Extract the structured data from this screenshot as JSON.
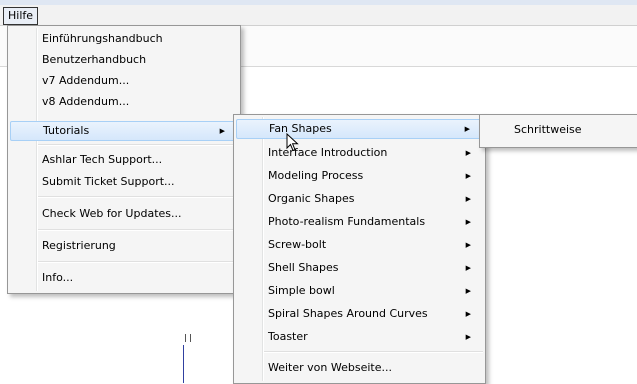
{
  "menubar": {
    "help_label": "Hilfe"
  },
  "help_menu": {
    "items": [
      {
        "label": "Einführungshandbuch"
      },
      {
        "label": "Benutzerhandbuch"
      },
      {
        "label": "v7 Addendum..."
      },
      {
        "label": "v8 Addendum..."
      },
      {
        "label": "Tutorials"
      },
      {
        "label": "Ashlar Tech Support..."
      },
      {
        "label": "Submit Ticket Support..."
      },
      {
        "label": "Check Web for Updates..."
      },
      {
        "label": "Registrierung"
      },
      {
        "label": "Info..."
      }
    ]
  },
  "tutorials_menu": {
    "items": [
      {
        "label": "Fan Shapes"
      },
      {
        "label": "Interface Introduction"
      },
      {
        "label": "Modeling Process"
      },
      {
        "label": "Organic Shapes"
      },
      {
        "label": "Photo-realism Fundamentals"
      },
      {
        "label": "Screw-bolt"
      },
      {
        "label": "Shell Shapes"
      },
      {
        "label": "Simple bowl"
      },
      {
        "label": "Spiral Shapes Around Curves"
      },
      {
        "label": "Toaster"
      },
      {
        "label": "Weiter von Webseite..."
      }
    ]
  },
  "fan_shapes_menu": {
    "items": [
      {
        "label": "Schrittweise"
      }
    ]
  },
  "icons": {
    "submenu_arrow": "chevron-right-icon",
    "cursor": "mouse-pointer-icon"
  }
}
